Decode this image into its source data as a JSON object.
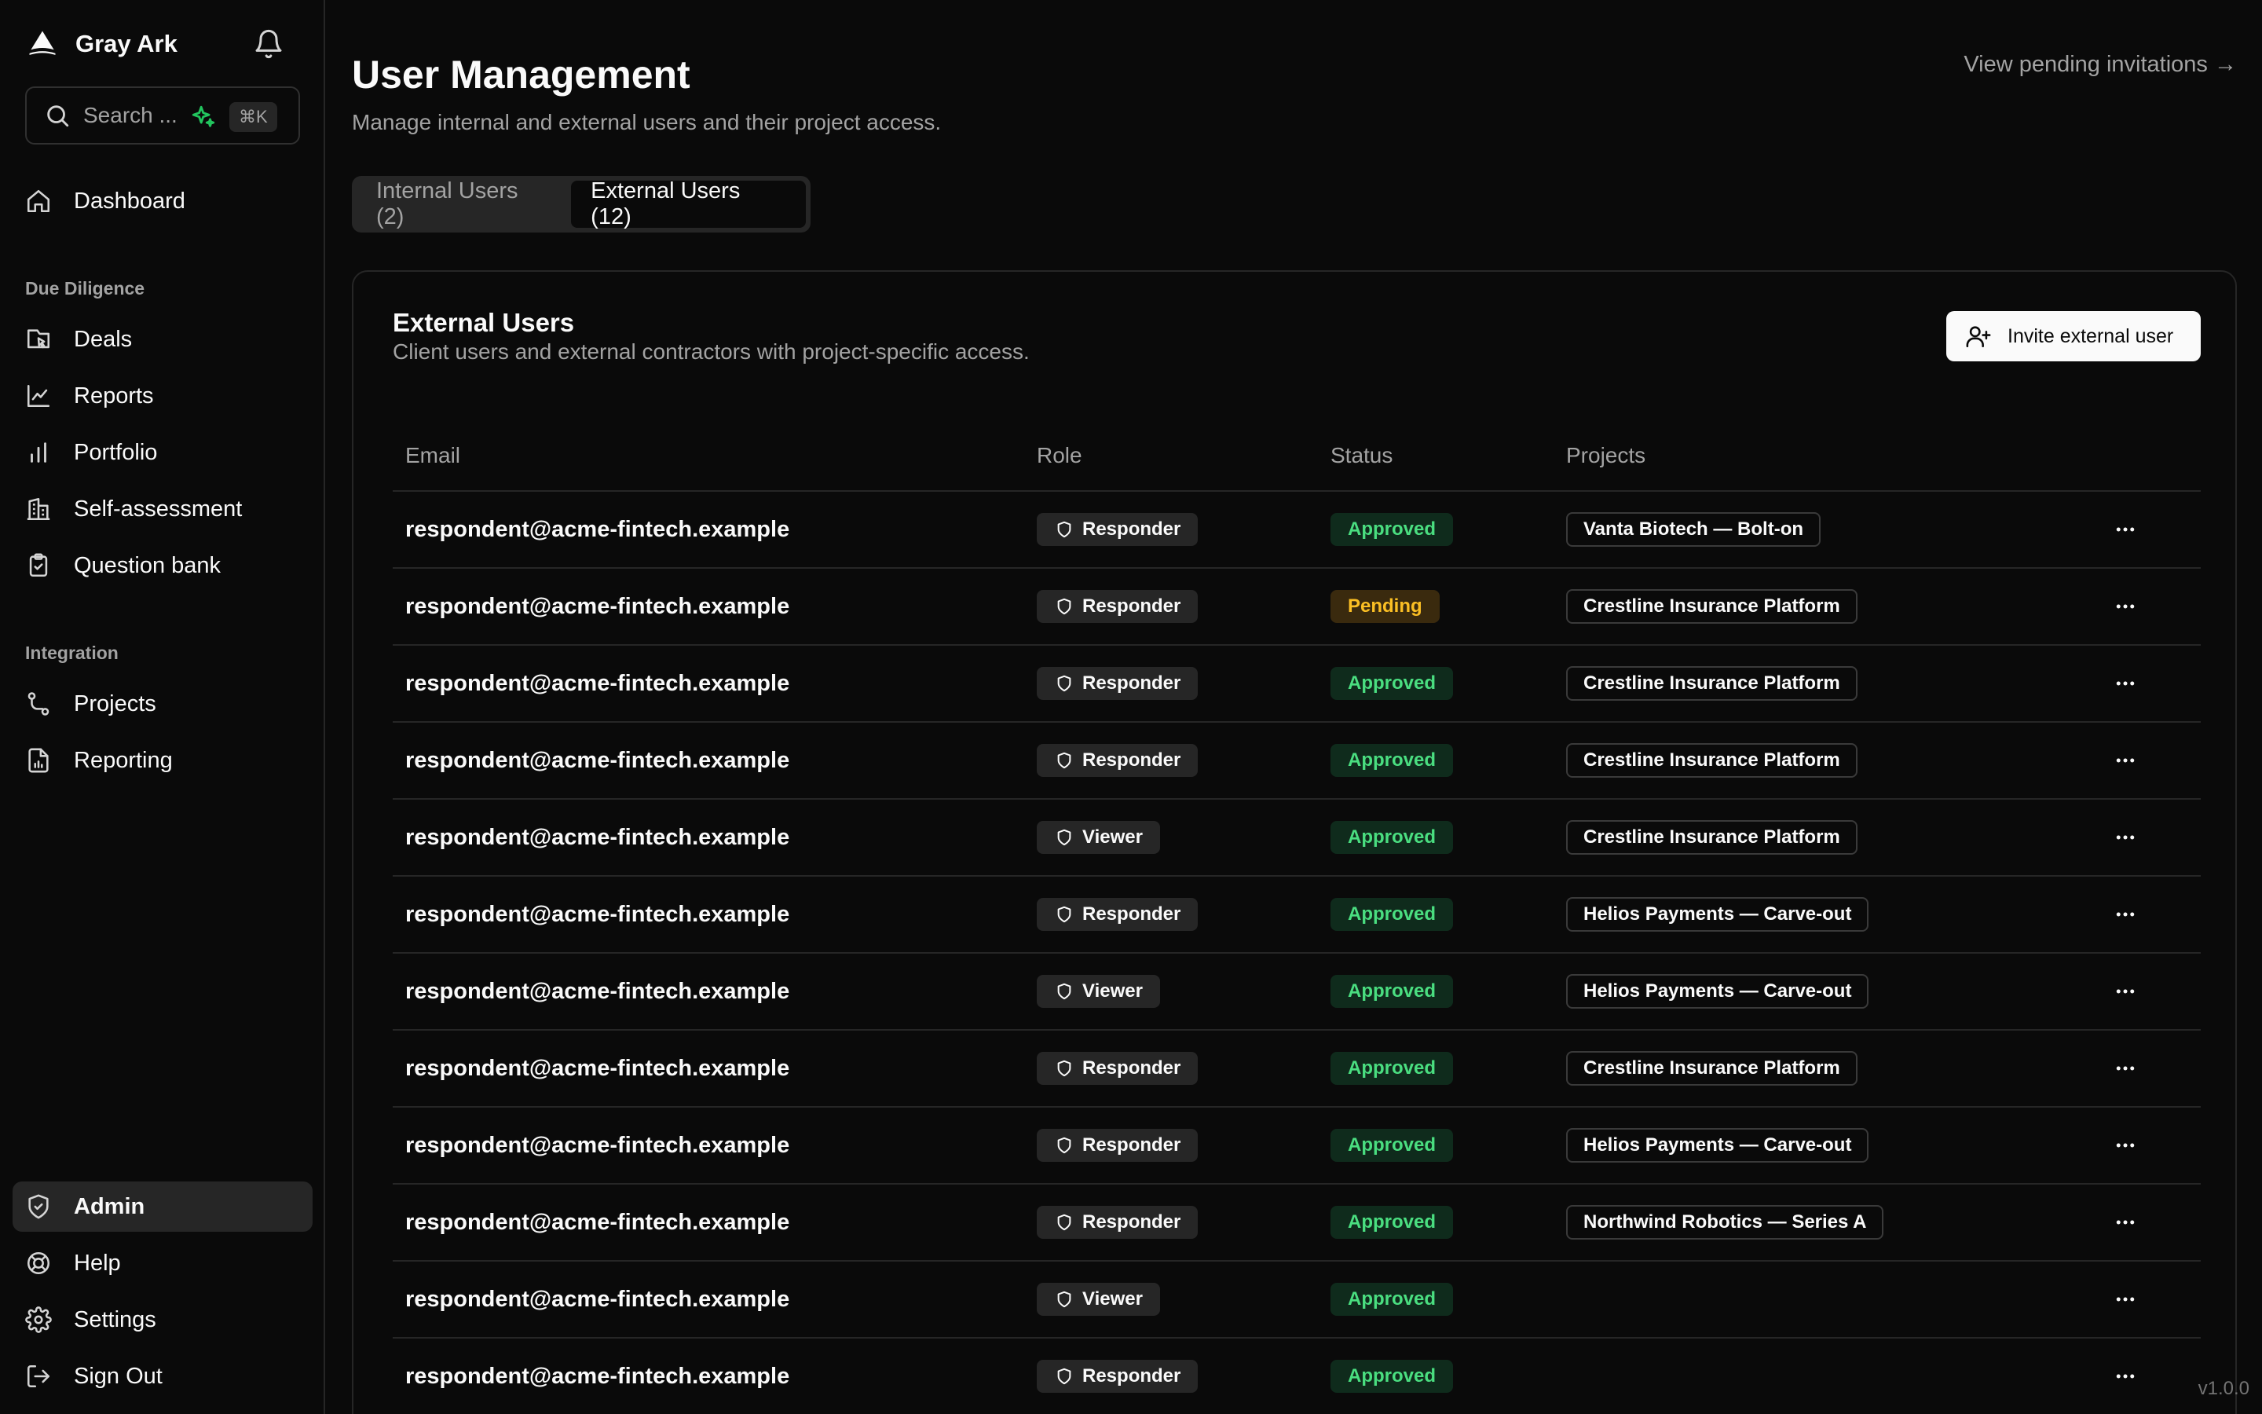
{
  "brand": {
    "name": "Gray Ark"
  },
  "search": {
    "placeholder": "Search ...",
    "shortcut": "⌘K"
  },
  "nav": {
    "top": [
      {
        "label": "Dashboard",
        "icon": "home-icon"
      }
    ],
    "due_diligence": {
      "label": "Due Diligence",
      "items": [
        {
          "label": "Deals",
          "icon": "deals-icon"
        },
        {
          "label": "Reports",
          "icon": "line-chart-icon"
        },
        {
          "label": "Portfolio",
          "icon": "bar-chart-icon"
        },
        {
          "label": "Self-assessment",
          "icon": "building-icon"
        },
        {
          "label": "Question bank",
          "icon": "clipboard-check-icon"
        }
      ]
    },
    "integration": {
      "label": "Integration",
      "items": [
        {
          "label": "Projects",
          "icon": "route-icon"
        },
        {
          "label": "Reporting",
          "icon": "file-chart-icon"
        }
      ]
    },
    "bottom": [
      {
        "label": "Admin",
        "icon": "shield-check-icon",
        "active": true
      },
      {
        "label": "Help",
        "icon": "life-buoy-icon"
      },
      {
        "label": "Settings",
        "icon": "gear-icon"
      },
      {
        "label": "Sign Out",
        "icon": "log-out-icon"
      }
    ]
  },
  "version": "v1.0.0",
  "page": {
    "title": "User Management",
    "subtitle": "Manage internal and external users and their project access.",
    "pending_link": "View pending invitations →"
  },
  "tabs": [
    {
      "label": "Internal Users (2)",
      "active": false
    },
    {
      "label": "External Users (12)",
      "active": true
    }
  ],
  "card": {
    "title": "External Users",
    "subtitle": "Client users and external contractors with project-specific access.",
    "invite_label": "Invite external user"
  },
  "table": {
    "columns": [
      "Email",
      "Role",
      "Status",
      "Projects"
    ],
    "rows": [
      {
        "email": "respondent@acme-fintech.example",
        "role": "Responder",
        "status": "Approved",
        "project": "Vanta Biotech — Bolt-on"
      },
      {
        "email": "respondent@acme-fintech.example",
        "role": "Responder",
        "status": "Pending",
        "project": "Crestline Insurance Platform"
      },
      {
        "email": "respondent@acme-fintech.example",
        "role": "Responder",
        "status": "Approved",
        "project": "Crestline Insurance Platform"
      },
      {
        "email": "respondent@acme-fintech.example",
        "role": "Responder",
        "status": "Approved",
        "project": "Crestline Insurance Platform"
      },
      {
        "email": "respondent@acme-fintech.example",
        "role": "Viewer",
        "status": "Approved",
        "project": "Crestline Insurance Platform"
      },
      {
        "email": "respondent@acme-fintech.example",
        "role": "Responder",
        "status": "Approved",
        "project": "Helios Payments — Carve-out"
      },
      {
        "email": "respondent@acme-fintech.example",
        "role": "Viewer",
        "status": "Approved",
        "project": "Helios Payments — Carve-out"
      },
      {
        "email": "respondent@acme-fintech.example",
        "role": "Responder",
        "status": "Approved",
        "project": "Crestline Insurance Platform"
      },
      {
        "email": "respondent@acme-fintech.example",
        "role": "Responder",
        "status": "Approved",
        "project": "Helios Payments — Carve-out"
      },
      {
        "email": "respondent@acme-fintech.example",
        "role": "Responder",
        "status": "Approved",
        "project": "Northwind Robotics — Series A"
      },
      {
        "email": "respondent@acme-fintech.example",
        "role": "Viewer",
        "status": "Approved",
        "project": ""
      },
      {
        "email": "respondent@acme-fintech.example",
        "role": "Responder",
        "status": "Approved",
        "project": ""
      }
    ]
  },
  "colors": {
    "background": "#0a0a0a",
    "approved": "#4ade80",
    "pending": "#fbbf24",
    "accent_spark": "#22c55e"
  }
}
